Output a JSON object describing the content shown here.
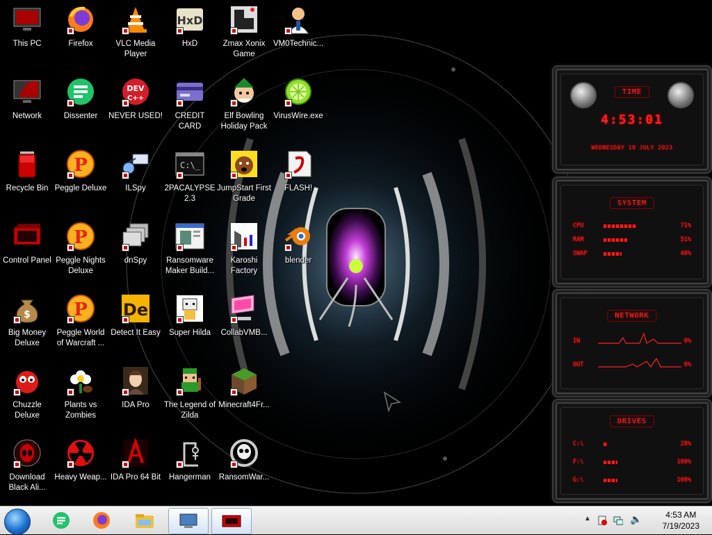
{
  "desktop": {
    "icons": [
      {
        "id": "this-pc",
        "label": "This PC",
        "col": 0,
        "row": 0,
        "icon": "monitor-icon"
      },
      {
        "id": "firefox",
        "label": "Firefox",
        "col": 1,
        "row": 0,
        "icon": "firefox-icon"
      },
      {
        "id": "vlc",
        "label": "VLC Media Player",
        "col": 2,
        "row": 0,
        "icon": "vlc-cone-icon"
      },
      {
        "id": "hxd",
        "label": "HxD",
        "col": 3,
        "row": 0,
        "icon": "hxd-icon"
      },
      {
        "id": "zmax",
        "label": "Zmax Xonix Game",
        "col": 4,
        "row": 0,
        "icon": "xonix-icon"
      },
      {
        "id": "vm0",
        "label": "VM0Technic...",
        "col": 5,
        "row": 0,
        "icon": "doctor-icon"
      },
      {
        "id": "network",
        "label": "Network",
        "col": 0,
        "row": 1,
        "icon": "network-icon"
      },
      {
        "id": "dissenter",
        "label": "Dissenter",
        "col": 1,
        "row": 1,
        "icon": "dissenter-icon"
      },
      {
        "id": "never-used",
        "label": "NEVER USED!",
        "col": 2,
        "row": 1,
        "icon": "devcpp-icon"
      },
      {
        "id": "cc-checker",
        "label": "CREDIT CARD CHECKER",
        "col": 3,
        "row": 1,
        "icon": "credit-card-icon"
      },
      {
        "id": "elf-bowling",
        "label": "Elf Bowling Holiday Pack",
        "col": 4,
        "row": 1,
        "icon": "elf-icon"
      },
      {
        "id": "viruswire",
        "label": "VirusWire.exe",
        "col": 5,
        "row": 1,
        "icon": "lime-icon"
      },
      {
        "id": "recycle",
        "label": "Recycle Bin",
        "col": 0,
        "row": 2,
        "icon": "recycle-bin-icon"
      },
      {
        "id": "peggle",
        "label": "Peggle Deluxe",
        "col": 1,
        "row": 2,
        "icon": "peggle-icon"
      },
      {
        "id": "ilspy",
        "label": "ILSpy",
        "col": 2,
        "row": 2,
        "icon": "ilspy-icon"
      },
      {
        "id": "2pac",
        "label": "2PACALYPSE 2.3",
        "col": 3,
        "row": 2,
        "icon": "console-icon"
      },
      {
        "id": "jumpstart",
        "label": "JumpStart First Grade",
        "col": 4,
        "row": 2,
        "icon": "dog-icon"
      },
      {
        "id": "flash",
        "label": "FLASH!",
        "col": 5,
        "row": 2,
        "icon": "flash-icon"
      },
      {
        "id": "control-panel",
        "label": "Control Panel",
        "col": 0,
        "row": 3,
        "icon": "control-panel-icon"
      },
      {
        "id": "peggle-nights",
        "label": "Peggle Nights Deluxe",
        "col": 1,
        "row": 3,
        "icon": "peggle-icon"
      },
      {
        "id": "dnspy",
        "label": "dnSpy",
        "col": 2,
        "row": 3,
        "icon": "dnspy-icon"
      },
      {
        "id": "ransomware-maker",
        "label": "Ransomware Maker Build...",
        "col": 3,
        "row": 3,
        "icon": "window-app-icon"
      },
      {
        "id": "karoshi",
        "label": "Karoshi Factory",
        "col": 4,
        "row": 3,
        "icon": "karoshi-icon"
      },
      {
        "id": "blender",
        "label": "blender",
        "col": 5,
        "row": 3,
        "icon": "blender-icon"
      },
      {
        "id": "big-money",
        "label": "Big Money Deluxe",
        "col": 0,
        "row": 4,
        "icon": "money-bag-icon"
      },
      {
        "id": "peggle-wow",
        "label": "Peggle World of Warcraft ...",
        "col": 1,
        "row": 4,
        "icon": "peggle-icon"
      },
      {
        "id": "detect-it-easy",
        "label": "Detect It Easy",
        "col": 2,
        "row": 4,
        "icon": "die-icon"
      },
      {
        "id": "super-hilda",
        "label": "Super Hilda",
        "col": 3,
        "row": 4,
        "icon": "pixel-hilda-icon"
      },
      {
        "id": "collabvm",
        "label": "CollabVMB...",
        "col": 4,
        "row": 4,
        "icon": "collab-icon"
      },
      {
        "id": "chuzzle",
        "label": "Chuzzle Deluxe",
        "col": 0,
        "row": 5,
        "icon": "chuzzle-icon"
      },
      {
        "id": "pvz",
        "label": "Plants vs Zombies",
        "col": 1,
        "row": 5,
        "icon": "flower-icon"
      },
      {
        "id": "ida-pro",
        "label": "IDA Pro",
        "col": 2,
        "row": 5,
        "icon": "ida-lady-icon"
      },
      {
        "id": "zilda",
        "label": "The Legend of Zilda",
        "col": 3,
        "row": 5,
        "icon": "pixel-link-icon"
      },
      {
        "id": "minecraft",
        "label": "Minecraft4Fr...",
        "col": 4,
        "row": 5,
        "icon": "grass-block-icon"
      },
      {
        "id": "black-ali",
        "label": "Download Black Ali...",
        "col": 0,
        "row": 6,
        "icon": "alien-orb-icon"
      },
      {
        "id": "heavy-weap",
        "label": "Heavy Weap...",
        "col": 1,
        "row": 6,
        "icon": "radiation-icon"
      },
      {
        "id": "ida-64",
        "label": "IDA Pro 64 Bit",
        "col": 2,
        "row": 6,
        "icon": "ida64-icon"
      },
      {
        "id": "hangerman",
        "label": "Hangerman",
        "col": 3,
        "row": 6,
        "icon": "hangerman-icon"
      },
      {
        "id": "ransomwar",
        "label": "RansomWar...",
        "col": 4,
        "row": 6,
        "icon": "skull-icon"
      }
    ]
  },
  "gadgets": {
    "time": {
      "title": "TIME",
      "clock": "4:53:01",
      "date": "WEDNESDAY 19 JULY 2023"
    },
    "system": {
      "title": "SYSTEM",
      "rows": [
        {
          "key": "CPU",
          "value": "71%",
          "fill": 0.71
        },
        {
          "key": "RAM",
          "value": "51%",
          "fill": 0.51
        },
        {
          "key": "SWAP",
          "value": "40%",
          "fill": 0.4
        }
      ]
    },
    "network": {
      "title": "NETWORK",
      "rows": [
        {
          "key": "IN",
          "value": "0%"
        },
        {
          "key": "OUT",
          "value": "0%"
        }
      ]
    },
    "drives": {
      "title": "DRIVES",
      "rows": [
        {
          "key": "C:\\",
          "value": "28%",
          "fill": 0.28
        },
        {
          "key": "F:\\",
          "value": "100%",
          "fill": 1.0
        },
        {
          "key": "G:\\",
          "value": "100%",
          "fill": 1.0
        }
      ]
    }
  },
  "taskbar": {
    "pinned": [
      {
        "id": "dissenter",
        "icon": "dissenter-icon"
      },
      {
        "id": "firefox",
        "icon": "firefox-icon"
      },
      {
        "id": "explorer",
        "icon": "folder-icon"
      },
      {
        "id": "remote",
        "icon": "remote-desktop-icon"
      },
      {
        "id": "control",
        "icon": "control-panel-icon"
      }
    ],
    "clock": {
      "time": "4:53 AM",
      "date": "7/19/2023"
    }
  },
  "colors": {
    "accent_red": "#ff2020",
    "taskbar_bg": "#e6e6e6",
    "desktop_bg": "#000000"
  }
}
